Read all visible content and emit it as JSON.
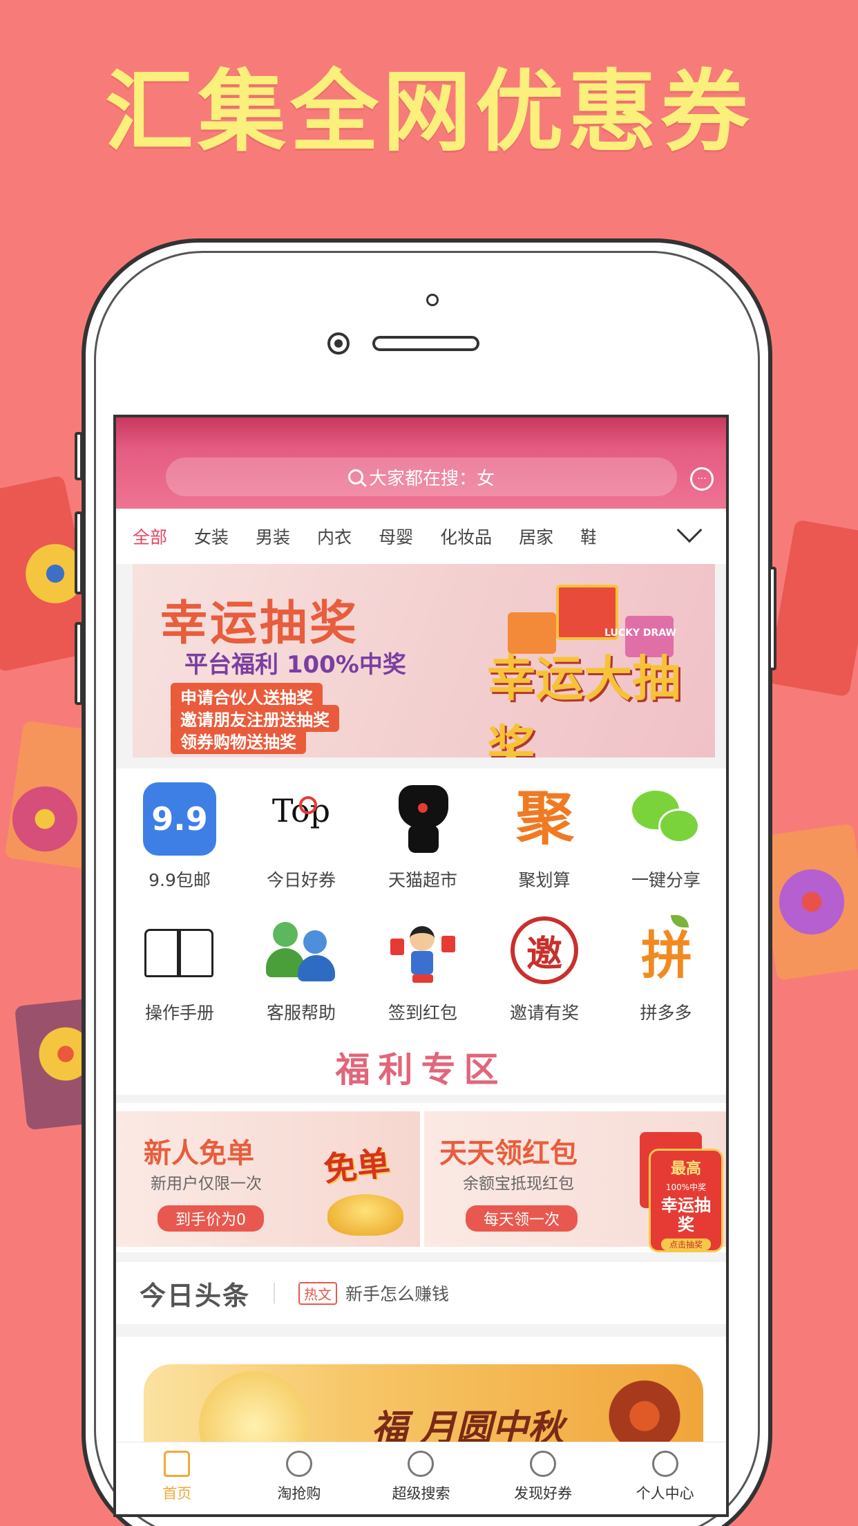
{
  "headline": "汇集全网优惠券",
  "colors": {
    "background": "#f77c79",
    "headline": "#fbf07b",
    "accent": "#e7455f",
    "nav_active": "#f2a73a"
  },
  "header": {
    "search_placeholder": "大家都在搜：女",
    "search_icon": "search-icon",
    "message_icon": "message-icon"
  },
  "categories": {
    "items": [
      "全部",
      "女装",
      "男装",
      "内衣",
      "母婴",
      "化妆品",
      "居家",
      "鞋"
    ],
    "active": "全部"
  },
  "banner": {
    "title": "幸运抽奖",
    "subtitle": "平台福利 100%中奖",
    "lines": [
      "申请合伙人送抽奖",
      "邀请朋友注册送抽奖",
      "领券购物送抽奖"
    ],
    "art_text": "幸运大抽奖",
    "art_small": "LUCKY DRAW"
  },
  "icon_grid": [
    {
      "label": "9.9包邮",
      "icon": "nine-nine-icon"
    },
    {
      "label": "今日好券",
      "icon": "top10-icon"
    },
    {
      "label": "天猫超市",
      "icon": "tmall-cat-icon"
    },
    {
      "label": "聚划算",
      "icon": "ju-icon"
    },
    {
      "label": "一键分享",
      "icon": "wechat-icon"
    },
    {
      "label": "操作手册",
      "icon": "book-icon"
    },
    {
      "label": "客服帮助",
      "icon": "support-people-icon"
    },
    {
      "label": "签到红包",
      "icon": "red-envelope-person-icon"
    },
    {
      "label": "邀请有奖",
      "icon": "invite-seal-icon"
    },
    {
      "label": "拼多多",
      "icon": "pin-icon"
    }
  ],
  "icon_texts": {
    "nine": "9.9",
    "top": "Top",
    "ju": "聚",
    "invite": "邀",
    "pin": "拼"
  },
  "welfare": {
    "title": "福利专区"
  },
  "promos": [
    {
      "title": "新人免单",
      "subtitle": "新用户仅限一次",
      "button": "到手价为0",
      "art": "免单"
    },
    {
      "title": "天天领红包",
      "subtitle": "余额宝抵现红包",
      "button": "每天领一次"
    }
  ],
  "float_lottery": {
    "top": "最高",
    "badge": "100%中奖",
    "title": "幸运抽奖",
    "button": "点击抽奖"
  },
  "news": {
    "logo": "今日头条",
    "tag": "热文",
    "text": "新手怎么赚钱"
  },
  "festival": {
    "text": "福 月圆中秋"
  },
  "bottom_nav": [
    {
      "label": "首页",
      "icon": "home-icon",
      "active": true
    },
    {
      "label": "淘抢购",
      "icon": "clock-icon",
      "active": false
    },
    {
      "label": "超级搜索",
      "icon": "search-icon",
      "active": false
    },
    {
      "label": "发现好券",
      "icon": "discover-icon",
      "active": false
    },
    {
      "label": "个人中心",
      "icon": "user-icon",
      "active": false
    }
  ]
}
